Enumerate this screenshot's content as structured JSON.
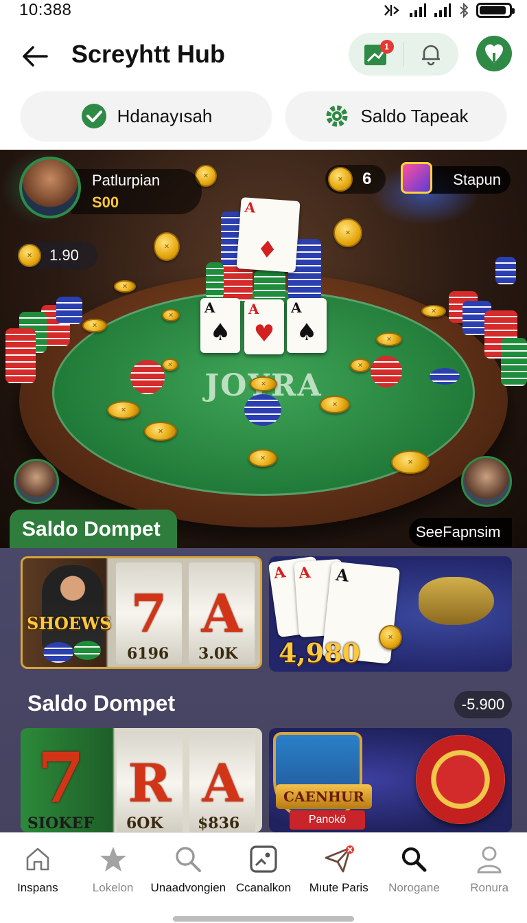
{
  "status_bar": {
    "time": "10:388"
  },
  "header": {
    "title": "Screyhtt Hub",
    "notification_count": "1"
  },
  "chips": [
    {
      "label": "Hdanayısah",
      "icon": "check-circle-icon"
    },
    {
      "label": "Saldo Tapeak",
      "icon": "gear-icon"
    }
  ],
  "hero": {
    "player_name": "Patlurpian",
    "player_amount": "S00",
    "coin_count": "6",
    "spin_label": "Stapun",
    "balance": "1.90",
    "table_logo": "JOYRA",
    "cards": [
      {
        "rank": "A",
        "suit": "♠",
        "color": "black"
      },
      {
        "rank": "A",
        "suit": "♥",
        "color": "red"
      },
      {
        "rank": "A",
        "suit": "♠",
        "color": "black"
      }
    ],
    "top_card": {
      "rank": "A",
      "suit": "♦",
      "color": "red"
    },
    "section_tab": "Saldo Dompet",
    "see_all": "SeeFapnsim"
  },
  "games_row_1": [
    {
      "title": "SHOEWS",
      "reels": [
        "7",
        "A"
      ],
      "stat_1": "6196",
      "stat_2": "3.0K"
    },
    {
      "amount": "4,980"
    }
  ],
  "section_2": {
    "title": "Saldo Dompet",
    "value": "-5.900"
  },
  "games_row_2": [
    {
      "title": "SIOKEF",
      "reels": [
        "7",
        "R",
        "A"
      ],
      "stat_1": "6OK",
      "stat_2": "$836"
    },
    {
      "title": "CAENHUR",
      "subtitle": "Panokö"
    }
  ],
  "bottom_nav": [
    {
      "label": "Inspans",
      "icon": "home-icon",
      "dark": true
    },
    {
      "label": "Lokelon",
      "icon": "star-icon",
      "dark": false
    },
    {
      "label": "Unaadvongien",
      "icon": "search-icon",
      "dark": true
    },
    {
      "label": "Ccanalkon",
      "icon": "photo-icon",
      "dark": true
    },
    {
      "label": "Mıute Paris",
      "icon": "paper-plane-icon",
      "dark": true
    },
    {
      "label": "Norogane",
      "icon": "search-icon",
      "dark": false
    },
    {
      "label": "Ronura",
      "icon": "user-icon",
      "dark": false
    }
  ],
  "colors": {
    "accent": "#2f8a46",
    "chip_bg": "#f2f3f2",
    "felt": "#2e8f45",
    "gold": "#ffc83a"
  }
}
